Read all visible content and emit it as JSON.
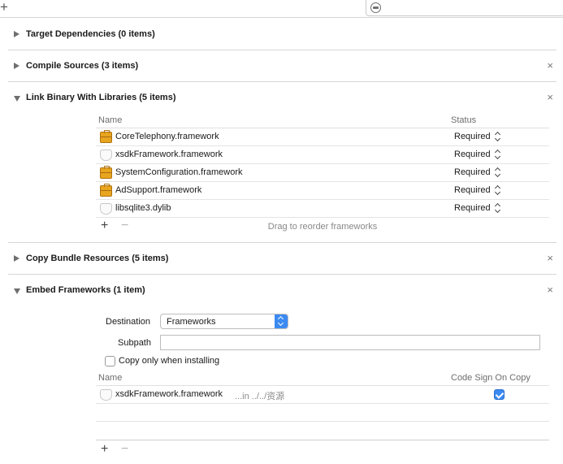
{
  "toolbar": {
    "add_label": "+"
  },
  "phases": [
    {
      "title": "Target Dependencies (0 items)",
      "expanded": false,
      "closable": false
    },
    {
      "title": "Compile Sources (3 items)",
      "expanded": false,
      "closable": true
    },
    {
      "title": "Link Binary With Libraries (5 items)",
      "expanded": true,
      "closable": true
    },
    {
      "title": "Copy Bundle Resources (5 items)",
      "expanded": false,
      "closable": true
    },
    {
      "title": "Embed Frameworks (1 item)",
      "expanded": true,
      "closable": true
    }
  ],
  "close_glyph": "×",
  "link_binary": {
    "col_name": "Name",
    "col_status": "Status",
    "rows": [
      {
        "name": "CoreTelephony.framework",
        "status": "Required",
        "icon": "toolbox-icon"
      },
      {
        "name": "xsdkFramework.framework",
        "status": "Required",
        "icon": "framework-shield-icon"
      },
      {
        "name": "SystemConfiguration.framework",
        "status": "Required",
        "icon": "toolbox-icon"
      },
      {
        "name": "AdSupport.framework",
        "status": "Required",
        "icon": "toolbox-icon"
      },
      {
        "name": "libsqlite3.dylib",
        "status": "Required",
        "icon": "framework-shield-icon"
      }
    ],
    "drag_hint": "Drag to reorder frameworks"
  },
  "embed": {
    "destination_label": "Destination",
    "destination_value": "Frameworks",
    "subpath_label": "Subpath",
    "subpath_value": "",
    "copy_only_label": "Copy only when installing",
    "copy_only_checked": false,
    "col_name": "Name",
    "col_codesign": "Code Sign On Copy",
    "rows": [
      {
        "name": "xsdkFramework.framework",
        "path": "...in ../../资源",
        "codesign": true,
        "icon": "framework-shield-icon"
      }
    ]
  },
  "tools": {
    "plus": "+",
    "minus": "−"
  },
  "colors": {
    "accent": "#3b8af2",
    "toolbox": "#e8a51e",
    "separator": "#d6d6d6"
  }
}
